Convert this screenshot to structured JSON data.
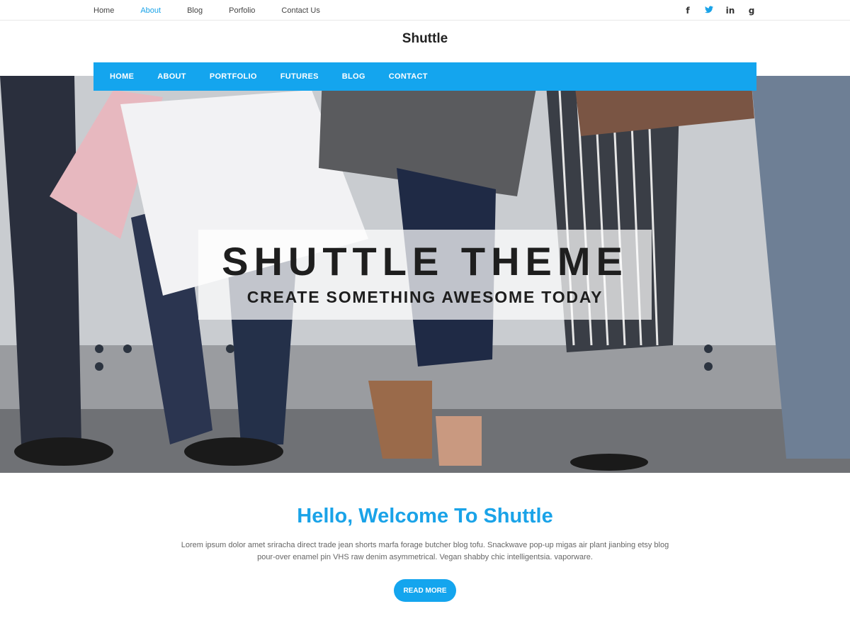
{
  "topbar": {
    "links": [
      "Home",
      "About",
      "Blog",
      "Porfolio",
      "Contact Us"
    ],
    "active_index": 1,
    "social": [
      {
        "icon": "facebook-icon",
        "glyph": "f"
      },
      {
        "icon": "twitter-icon",
        "glyph": "t"
      },
      {
        "icon": "linkedin-icon",
        "glyph": "in"
      },
      {
        "icon": "google-plus-icon",
        "glyph": "g"
      }
    ]
  },
  "site_title": "Shuttle",
  "main_nav": [
    "HOME",
    "ABOUT",
    "PORTFOLIO",
    "FUTURES",
    "BLOG",
    "CONTACT"
  ],
  "hero": {
    "title": "SHUTTLE THEME",
    "subtitle": "CREATE SOMETHING AWESOME TODAY"
  },
  "welcome": {
    "title": "Hello, Welcome To Shuttle",
    "text_line1": "Lorem ipsum dolor amet sriracha direct trade jean shorts marfa forage butcher blog tofu. Snackwave pop-up migas air plant  jianbing etsy blog",
    "text_line2": "pour-over enamel pin VHS raw denim asymmetrical. Vegan shabby chic intelligentsia. vaporware.",
    "button": "READ MORE"
  },
  "colors": {
    "accent": "#14a5ee",
    "link_active": "#1aa3e8",
    "text_dark": "#222222",
    "text_body": "#666666"
  }
}
